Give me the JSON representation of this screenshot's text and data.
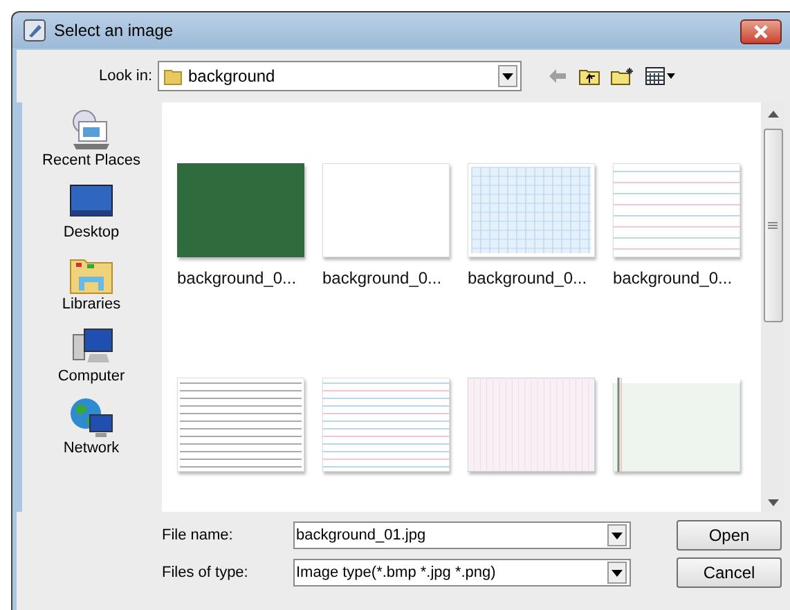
{
  "window": {
    "title": "Select an image"
  },
  "look_in": {
    "label": "Look in:",
    "value": "background"
  },
  "places": [
    {
      "label": "Recent Places",
      "kind": "recent"
    },
    {
      "label": "Desktop",
      "kind": "desktop"
    },
    {
      "label": "Libraries",
      "kind": "libraries"
    },
    {
      "label": "Computer",
      "kind": "computer"
    },
    {
      "label": "Network",
      "kind": "network"
    }
  ],
  "files": [
    {
      "label": "background_0...",
      "kind": "picture"
    },
    {
      "label": "background_0...",
      "kind": "picture"
    },
    {
      "label": "background_0...",
      "kind": "picture"
    },
    {
      "label": "background_0...",
      "kind": "picture"
    },
    {
      "kind": "picture"
    },
    {
      "kind": "picture"
    },
    {
      "kind": "picture"
    },
    {
      "kind": "picture"
    }
  ],
  "file_name": {
    "label": "File name:",
    "value": "background_01.jpg"
  },
  "file_type": {
    "label": "Files of type:",
    "value": "Image type(*.bmp *.jpg *.png)"
  },
  "buttons": [
    "Open",
    "Cancel"
  ]
}
